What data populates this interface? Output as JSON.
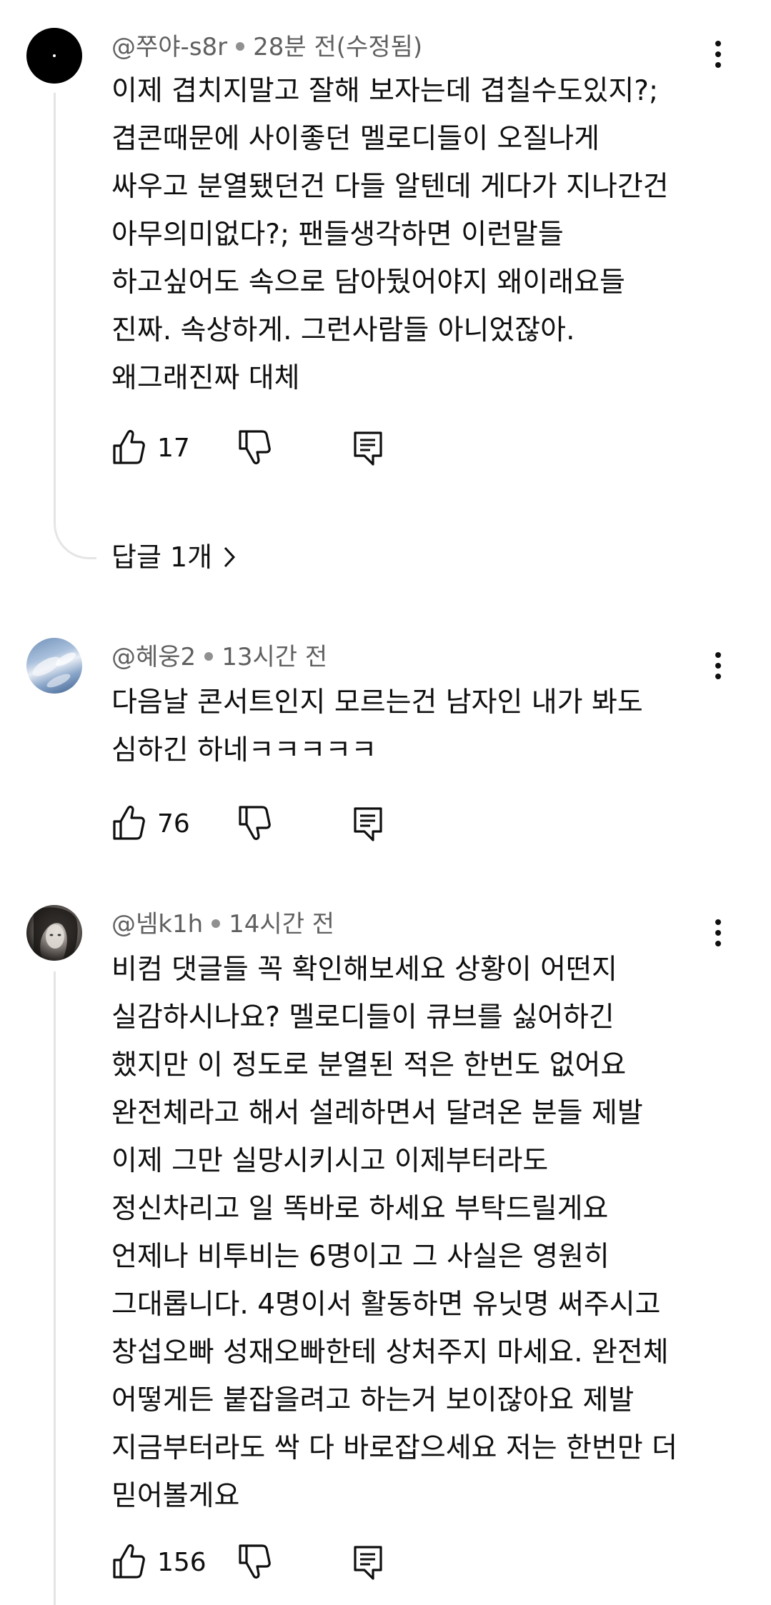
{
  "comments": [
    {
      "author": "@쭈야-s8r",
      "time": "28분 전(수정됨)",
      "lines": [
        "이제 겹치지말고 잘해 보자는데 겹칠수도있지?;",
        "겹콘때문에 사이좋던 멜로디들이 오질나게",
        "싸우고 분열됐던건 다들 알텐데 게다가 지나간건",
        "아무의미없다?; 팬들생각하면 이런말들",
        "하고싶어도 속으로 담아뒀어야지 왜이래요들",
        "진짜. 속상하게. 그런사람들 아니었잖아.",
        "왜그래진짜 대체"
      ],
      "likes": "17",
      "replies_label": "답글 1개"
    },
    {
      "author": "@혜웅2",
      "time": "13시간 전",
      "lines": [
        "다음날 콘서트인지 모르는건 남자인 내가 봐도",
        "심하긴 하네ㅋㅋㅋㅋㅋ"
      ],
      "likes": "76"
    },
    {
      "author": "@넴k1h",
      "time": "14시간 전",
      "lines": [
        "비컴 댓글들 꼭 확인해보세요 상황이 어떤지",
        "실감하시나요? 멜로디들이 큐브를 싫어하긴",
        "했지만 이 정도로 분열된 적은 한번도 없어요",
        "완전체라고 해서 설레하면서 달려온 분들 제발",
        "이제 그만 실망시키시고 이제부터라도",
        "정신차리고 일 똑바로 하세요 부탁드릴게요",
        "언제나 비투비는 6명이고 그 사실은 영원히",
        "그대롭니다. 4명이서 활동하면 유닛명 써주시고",
        "창섭오빠 성재오빠한테 상처주지 마세요. 완전체",
        "어떻게든 붙잡을려고 하는거 보이잖아요 제발",
        "지금부터라도 싹 다 바로잡으세요 저는 한번만 더",
        "믿어볼게요"
      ],
      "likes": "156"
    }
  ],
  "icons": {
    "like": "thumbs-up-icon",
    "dislike": "thumbs-down-icon",
    "reply": "reply-icon",
    "more": "more-vertical-icon",
    "chevron": "chevron-right-icon"
  }
}
